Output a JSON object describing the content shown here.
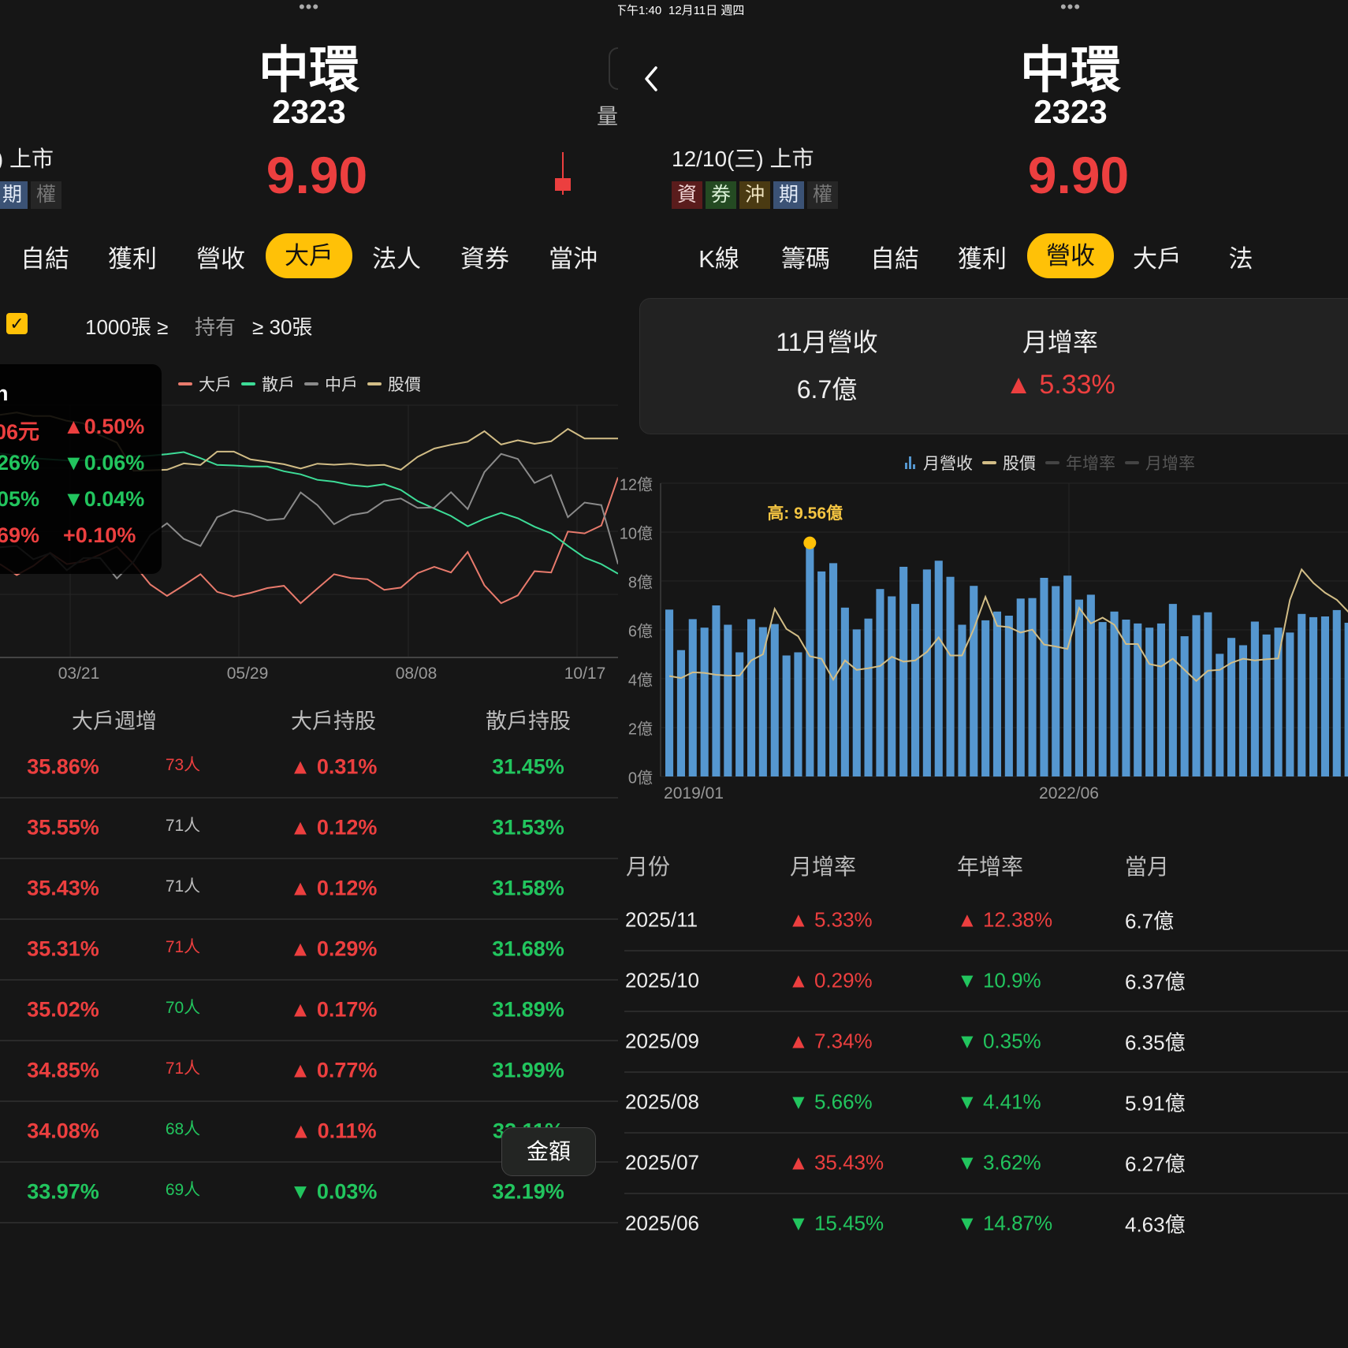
{
  "status_bar": {
    "time": "下午1:40",
    "date": "12月11日 週四"
  },
  "stock": {
    "name": "中環",
    "code": "2323",
    "price": "9.90",
    "market_date": "12/10(三) 上市",
    "volume_label": "量"
  },
  "badges": [
    {
      "label": "資",
      "bg": "#5a1c1c",
      "fg": "#f2d6d6"
    },
    {
      "label": "券",
      "bg": "#244a22",
      "fg": "#d9f0d6"
    },
    {
      "label": "沖",
      "bg": "#4a3a12",
      "fg": "#f0e4c0"
    },
    {
      "label": "期",
      "bg": "#3b5275",
      "fg": "#e4ecf8"
    },
    {
      "label": "權",
      "bg": "#262626",
      "fg": "#777777"
    }
  ],
  "left": {
    "tabs": [
      "自結",
      "獲利",
      "營收",
      "大戶",
      "法人",
      "資券",
      "當沖"
    ],
    "active_tab": "大戶",
    "filter": {
      "min_label": "1000張 ≥",
      "mid_label": "持有",
      "max_label": "≥ 30張",
      "checked": true
    },
    "legend": [
      "大戶",
      "散戶",
      "中戶",
      "股價"
    ],
    "tooltip": {
      "title": "n",
      "rows": [
        {
          "value": "06元",
          "change": "▲0.50%",
          "color": "red"
        },
        {
          "value": ".26%",
          "change": "▼0.06%",
          "color": "green"
        },
        {
          "value": ".05%",
          "change": "▼0.04%",
          "color": "green"
        },
        {
          "value": ".69%",
          "change": "+0.10%",
          "color": "red"
        }
      ]
    },
    "table": {
      "headers": [
        "大戶週增",
        "大戶持股",
        "散戶持股"
      ],
      "rows": [
        {
          "pct": "35.86%",
          "pct_color": "red",
          "people": "73人",
          "people_color": "red",
          "change": "▲ 0.31%",
          "change_color": "red",
          "retail": "31.45%"
        },
        {
          "pct": "35.55%",
          "pct_color": "red",
          "people": "71人",
          "people_color": "gray",
          "change": "▲ 0.12%",
          "change_color": "red",
          "retail": "31.53%"
        },
        {
          "pct": "35.43%",
          "pct_color": "red",
          "people": "71人",
          "people_color": "gray",
          "change": "▲ 0.12%",
          "change_color": "red",
          "retail": "31.58%"
        },
        {
          "pct": "35.31%",
          "pct_color": "red",
          "people": "71人",
          "people_color": "red",
          "change": "▲ 0.29%",
          "change_color": "red",
          "retail": "31.68%"
        },
        {
          "pct": "35.02%",
          "pct_color": "red",
          "people": "70人",
          "people_color": "green",
          "change": "▲ 0.17%",
          "change_color": "red",
          "retail": "31.89%"
        },
        {
          "pct": "34.85%",
          "pct_color": "red",
          "people": "71人",
          "people_color": "red",
          "change": "▲ 0.77%",
          "change_color": "red",
          "retail": "31.99%"
        },
        {
          "pct": "34.08%",
          "pct_color": "red",
          "people": "68人",
          "people_color": "green",
          "change": "▲ 0.11%",
          "change_color": "red",
          "retail": "32.11%"
        },
        {
          "pct": "33.97%",
          "pct_color": "green",
          "people": "69人",
          "people_color": "green",
          "change": "▼ 0.03%",
          "change_color": "green",
          "retail": "32.19%"
        }
      ]
    },
    "amount_button": "金額"
  },
  "right": {
    "tabs": [
      "K線",
      "籌碼",
      "自結",
      "獲利",
      "營收",
      "大戶",
      "法"
    ],
    "active_tab": "營收",
    "summary": {
      "revenue_label": "11月營收",
      "revenue_value": "6.7億",
      "mom_label": "月增率",
      "mom_value": "▲ 5.33%"
    },
    "legend": [
      "月營收",
      "股價",
      "年增率",
      "月增率"
    ],
    "table": {
      "headers": [
        "月份",
        "月增率",
        "年增率",
        "當月"
      ],
      "rows": [
        {
          "month": "2025/11",
          "mom": "▲ 5.33%",
          "mom_color": "red",
          "yoy": "▲ 12.38%",
          "yoy_color": "red",
          "revenue": "6.7億"
        },
        {
          "month": "2025/10",
          "mom": "▲ 0.29%",
          "mom_color": "red",
          "yoy": "▼ 10.9%",
          "yoy_color": "green",
          "revenue": "6.37億"
        },
        {
          "month": "2025/09",
          "mom": "▲ 7.34%",
          "mom_color": "red",
          "yoy": "▼ 0.35%",
          "yoy_color": "green",
          "revenue": "6.35億"
        },
        {
          "month": "2025/08",
          "mom": "▼ 5.66%",
          "mom_color": "green",
          "yoy": "▼ 4.41%",
          "yoy_color": "green",
          "revenue": "5.91億"
        },
        {
          "month": "2025/07",
          "mom": "▲ 35.43%",
          "mom_color": "red",
          "yoy": "▼ 3.62%",
          "yoy_color": "green",
          "revenue": "6.27億"
        },
        {
          "month": "2025/06",
          "mom": "▼ 15.45%",
          "mom_color": "green",
          "yoy": "▼ 14.87%",
          "yoy_color": "green",
          "revenue": "4.63億"
        }
      ]
    }
  },
  "colors": {
    "up": "#ec3f3f",
    "down": "#22c55e",
    "accent": "#ffc107",
    "bar": "#5597d0",
    "price_line": "#d2bd86",
    "big": "#e87a6c",
    "retail": "#3ddc97",
    "mid": "#8a8a8a"
  },
  "chart_data": [
    {
      "type": "line",
      "title": "大戶持股",
      "x_tick_labels": [
        "03/21",
        "05/29",
        "08/08",
        "10/17"
      ],
      "y_units": "relative (axis unlabeled, 0-100)",
      "ylim": [
        0,
        100
      ],
      "grid": true,
      "legend_position": "top",
      "series": [
        {
          "name": "大戶",
          "values": [
            37.0,
            32.7,
            36.3,
            41.5,
            37.0,
            38.0,
            40.8,
            43.9,
            37.0,
            28.9,
            24.4,
            28.6,
            33.0,
            26.0,
            24.1,
            25.6,
            27.5,
            28.4,
            21.5,
            27.3,
            33.0,
            31.5,
            31.0,
            26.8,
            27.7,
            33.4,
            35.9,
            33.7,
            41.8,
            28.6,
            21.5,
            24.6,
            34.2,
            33.7,
            49.9,
            49.2,
            52.3,
            71.4
          ]
        },
        {
          "name": "散戶",
          "values": [
            80.9,
            80.0,
            79.0,
            78.5,
            78.1,
            78.2,
            78.5,
            79.0,
            79.5,
            80.0,
            80.6,
            81.4,
            79.0,
            76.3,
            76.1,
            75.7,
            75.7,
            73.8,
            72.6,
            70.4,
            69.7,
            68.3,
            67.7,
            68.7,
            66.4,
            62.0,
            59.0,
            56.1,
            52.0,
            55.0,
            57.3,
            55.2,
            51.8,
            49.2,
            44.2,
            39.6,
            37.0,
            33.2
          ]
        },
        {
          "name": "中戶",
          "values": [
            43.7,
            44.2,
            38.9,
            41.3,
            34.6,
            39.4,
            39.4,
            31.3,
            38.0,
            48.5,
            53.2,
            47.0,
            44.2,
            55.6,
            58.3,
            56.9,
            54.4,
            55.0,
            65.4,
            60.4,
            52.8,
            56.4,
            57.5,
            62.0,
            63.0,
            59.3,
            59.4,
            65.5,
            58.8,
            73.5,
            80.7,
            78.7,
            69.2,
            72.3,
            55.6,
            61.4,
            60.4,
            37.0
          ]
        },
        {
          "name": "股價",
          "values": [
            96.2,
            97.1,
            95.7,
            95.7,
            93.8,
            92.8,
            88.1,
            85.2,
            74.0,
            74.2,
            74.4,
            76.9,
            76.3,
            81.6,
            81.6,
            78.5,
            77.6,
            76.6,
            74.9,
            76.8,
            76.4,
            76.8,
            76.1,
            76.3,
            74.4,
            79.5,
            82.8,
            84.3,
            85.5,
            89.7,
            84.4,
            86.1,
            84.7,
            85.7,
            90.6,
            86.8,
            86.8,
            86.8
          ]
        }
      ]
    },
    {
      "type": "bar",
      "title": "月營收",
      "x_tick_labels": [
        "2019/01",
        "2022/06"
      ],
      "y_tick_labels": [
        "0億",
        "2億",
        "4億",
        "6億",
        "8億",
        "10億",
        "12億"
      ],
      "ylim": [
        0,
        12
      ],
      "ylabel": "億",
      "grid": true,
      "legend_position": "top-right",
      "annotation": "高: 9.56億",
      "max_index": 12,
      "series": [
        {
          "name": "月營收",
          "values": [
            6.83,
            5.17,
            6.44,
            6.09,
            7.0,
            6.21,
            5.08,
            6.44,
            6.11,
            6.24,
            4.95,
            5.08,
            9.56,
            8.39,
            8.73,
            6.91,
            6.02,
            6.46,
            7.67,
            7.37,
            8.58,
            7.06,
            8.47,
            8.83,
            8.17,
            6.21,
            7.8,
            6.39,
            6.75,
            6.58,
            7.28,
            7.3,
            8.13,
            7.79,
            8.22,
            7.24,
            7.44,
            6.32,
            6.75,
            6.42,
            6.26,
            6.09,
            6.26,
            7.06,
            5.74,
            6.6,
            6.72,
            5.02,
            5.67,
            5.37,
            6.34,
            5.81,
            6.09,
            5.89,
            6.65,
            6.52,
            6.55,
            6.81,
            6.29
          ]
        },
        {
          "name": "股價",
          "values": [
            4.11,
            4.03,
            4.26,
            4.24,
            4.16,
            4.13,
            4.13,
            4.75,
            5.0,
            6.86,
            6.04,
            5.74,
            4.92,
            4.82,
            3.96,
            4.75,
            4.36,
            4.43,
            4.52,
            4.9,
            4.7,
            4.75,
            5.1,
            5.69,
            4.95,
            4.95,
            6.04,
            7.35,
            6.16,
            6.11,
            5.89,
            6.01,
            5.4,
            5.32,
            5.22,
            6.9,
            6.26,
            6.5,
            6.21,
            5.42,
            5.42,
            4.6,
            4.5,
            4.82,
            4.36,
            3.91,
            4.33,
            4.36,
            4.65,
            4.82,
            4.75,
            4.8,
            4.83,
            7.23,
            8.47,
            7.92,
            7.52,
            7.23,
            6.73
          ]
        }
      ]
    }
  ]
}
